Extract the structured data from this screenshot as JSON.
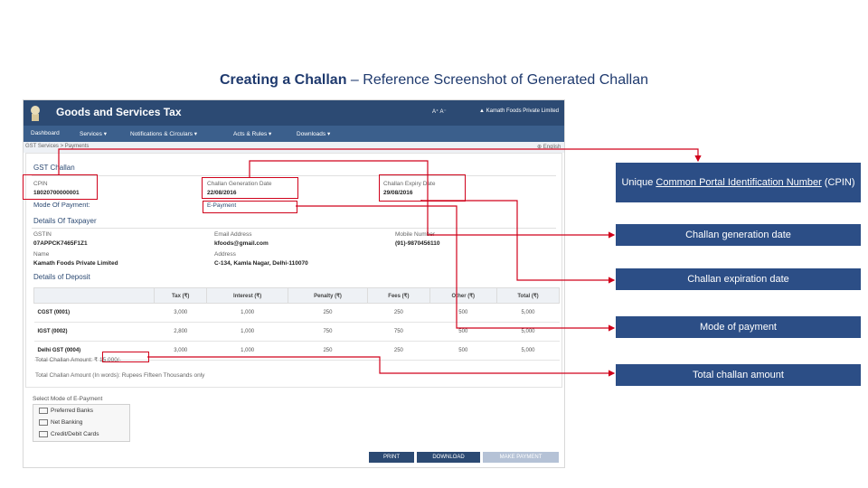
{
  "slide_title": {
    "bold": "Creating a Challan",
    "rest": " – Reference Screenshot of Generated Challan"
  },
  "gst": {
    "app_title": "Goods and Services Tax",
    "header_right": "▲ Kamath Foods Private Limited",
    "header_small": "A⁺  A⁻",
    "nav": [
      "Dashboard",
      "Services ▾",
      "Notifications & Circulars ▾",
      "Acts & Rules ▾",
      "Downloads ▾"
    ],
    "breadcrumb_left": "GST Services > Payments",
    "breadcrumb_right": "⊕ English",
    "page_heading": "GST Challan",
    "cpin_label": "CPIN",
    "cpin_value": "18020700000001",
    "gen_date_label": "Challan Generation Date",
    "gen_date_value": "22/08/2016",
    "exp_date_label": "Challan Expiry Date",
    "exp_date_value": "29/08/2016",
    "mode_label": "Mode Of Payment:",
    "mode_value": "E-Payment",
    "taxpayer_heading": "Details Of Taxpayer",
    "gstin_label": "GSTIN",
    "gstin_value": "07APPCK7465F1Z1",
    "email_label": "Email Address",
    "email_value": "kfoods@gmail.com",
    "mobile_label": "Mobile Number",
    "mobile_value": "(91)-9870456110",
    "name_label": "Name",
    "name_value": "Kamath Foods Private Limited",
    "address_label": "Address",
    "address_value": "C-134, Kamla Nagar, Delhi-110070",
    "deposit_heading": "Details of Deposit",
    "table_headers": [
      "",
      "Tax (₹)",
      "Interest (₹)",
      "Penalty (₹)",
      "Fees (₹)",
      "Other (₹)",
      "Total (₹)"
    ],
    "table_rows": [
      [
        "CGST (0001)",
        "3,000",
        "1,000",
        "250",
        "250",
        "500",
        "5,000"
      ],
      [
        "IGST (0002)",
        "2,800",
        "1,000",
        "750",
        "750",
        "500",
        "5,000"
      ],
      [
        "Delhi GST (0004)",
        "3,000",
        "1,000",
        "250",
        "250",
        "500",
        "5,000"
      ]
    ],
    "total_amount_label": "Total Challan Amount: ₹ 15,000/-",
    "total_words_label": "Total Challan Amount (In words): Rupees Fifteen Thousands only",
    "modes_title": "Select Mode of E-Payment",
    "modes": [
      "Preferred Banks",
      "Net Banking",
      "Credit/Debit Cards"
    ],
    "buttons": {
      "print": "PRINT",
      "download": "DOWNLOAD",
      "make_payment": "MAKE PAYMENT"
    }
  },
  "callouts": {
    "cpin_line1": "Unique ",
    "cpin_underlined": "Common Portal Identification Number",
    "cpin_line2": " (CPIN)",
    "gen_date": "Challan generation date",
    "exp_date": "Challan expiration date",
    "mode": "Mode of payment",
    "total": "Total challan amount"
  },
  "colors": {
    "header": "#2c4a73",
    "callout": "#2c4e86",
    "highlight": "#d0021b",
    "title": "#1f3a6e"
  }
}
